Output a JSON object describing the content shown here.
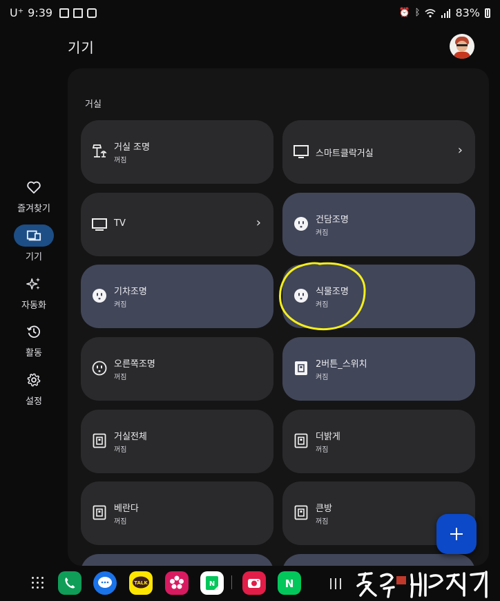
{
  "status_bar": {
    "carrier": "U⁺",
    "time": "9:39",
    "battery": "83%"
  },
  "header": {
    "title": "기기"
  },
  "nav": {
    "items": [
      {
        "label": "즐겨찾기",
        "icon": "heart-icon",
        "active": false
      },
      {
        "label": "기기",
        "icon": "devices-icon",
        "active": true
      },
      {
        "label": "자동화",
        "icon": "sparkle-icon",
        "active": false
      },
      {
        "label": "활동",
        "icon": "history-icon",
        "active": false
      },
      {
        "label": "설정",
        "icon": "gear-icon",
        "active": false
      }
    ]
  },
  "room": {
    "label": "거실"
  },
  "devices": [
    {
      "name": "거실 조명",
      "state": "꺼짐",
      "icon": "lamp-icon",
      "on": false
    },
    {
      "name": "스마트클락거실",
      "state": "",
      "icon": "display-icon",
      "on": false,
      "chevron": "›"
    },
    {
      "name": "TV",
      "state": "",
      "icon": "tv-icon",
      "on": false,
      "chevron": "›"
    },
    {
      "name": "건담조명",
      "state": "켜짐",
      "icon": "outlet-icon",
      "on": true
    },
    {
      "name": "기차조명",
      "state": "켜짐",
      "icon": "outlet-icon",
      "on": true
    },
    {
      "name": "식물조명",
      "state": "켜짐",
      "icon": "outlet-icon",
      "on": true
    },
    {
      "name": "오른쪽조명",
      "state": "꺼짐",
      "icon": "outlet-icon",
      "on": false
    },
    {
      "name": "2버튼_스위치",
      "state": "켜짐",
      "icon": "switch-icon",
      "on": true
    },
    {
      "name": "거실전체",
      "state": "꺼짐",
      "icon": "switch-icon",
      "on": false
    },
    {
      "name": "더밝게",
      "state": "꺼짐",
      "icon": "switch-icon",
      "on": false
    },
    {
      "name": "베란다",
      "state": "꺼짐",
      "icon": "switch-icon",
      "on": false
    },
    {
      "name": "큰방",
      "state": "꺼짐",
      "icon": "switch-icon",
      "on": false
    }
  ],
  "fab": {
    "icon": "plus-icon"
  },
  "dock": {
    "apps": [
      {
        "name": "phone",
        "color": "#0f9d58"
      },
      {
        "name": "messages",
        "color": "#1a73e8"
      },
      {
        "name": "kakaotalk",
        "color": "#fee500",
        "text": "TALK"
      },
      {
        "name": "blossom",
        "color": "#d81b60"
      },
      {
        "name": "naver-blog",
        "color": "#ffffff",
        "text": "N"
      },
      {
        "name": "camera",
        "color": "#e11d48"
      },
      {
        "name": "naver",
        "color": "#03c75a",
        "text": "N"
      }
    ]
  },
  "colors": {
    "background": "#0c0c0d",
    "panel": "#151516",
    "tile_off": "#2a2a2c",
    "tile_on": "#414659",
    "accent": "#0c49c8",
    "nav_active": "#1d4e85",
    "annotation": "#f5ef1a"
  }
}
